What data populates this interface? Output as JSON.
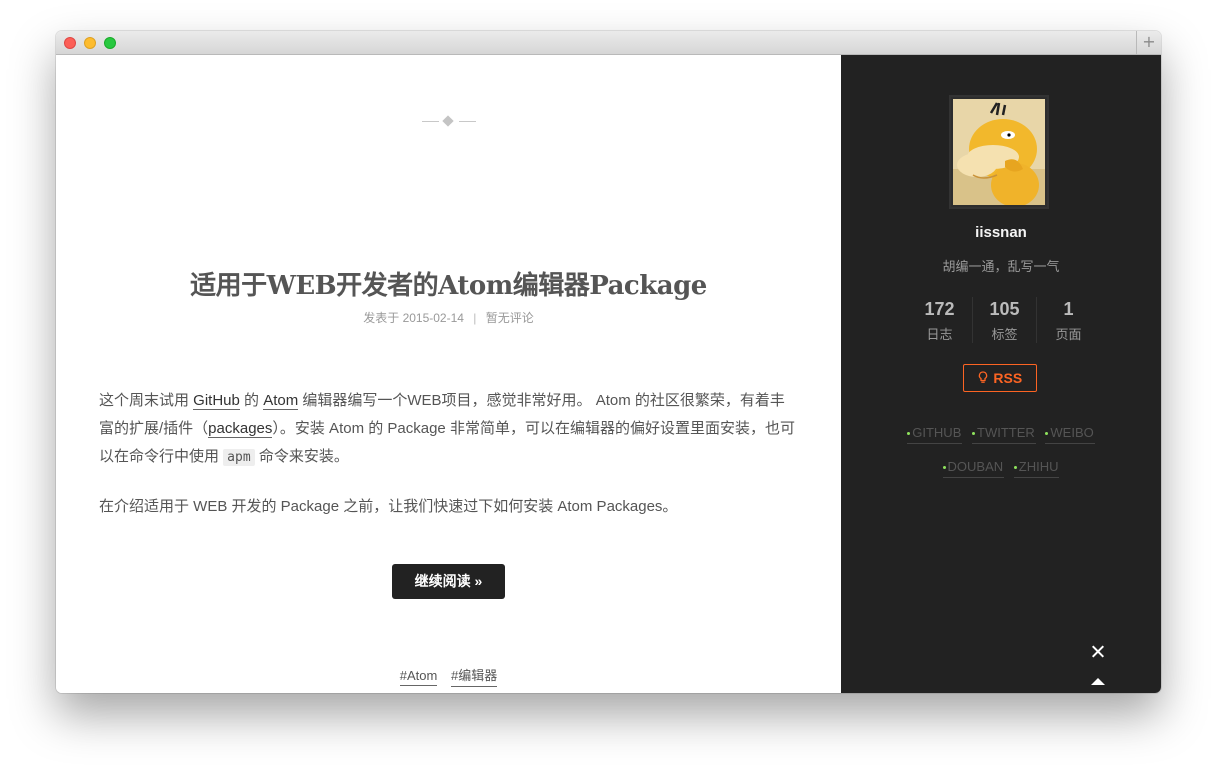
{
  "post": {
    "title": "适用于WEB开发者的Atom编辑器Package",
    "meta": {
      "posted_prefix": "发表于",
      "date": "2015-02-14",
      "separator": "|",
      "comments": "暂无评论"
    },
    "body": {
      "p1": {
        "t1": "这个周末试用 ",
        "link_github": "GitHub",
        "t2": " 的 ",
        "link_atom": "Atom",
        "t3": " 编辑器编写一个WEB项目，感觉非常好用。 Atom 的社区很繁荣，有着丰富的扩展/插件（",
        "link_packages": "packages",
        "t4": "）。安装 Atom 的 Package 非常简单，可以在编辑器的偏好设置里面安装，也可以在命令行中使用 ",
        "code_apm": "apm",
        "t5": " 命令来安装。"
      },
      "p2": "在介绍适用于 WEB 开发的 Package 之前，让我们快速过下如何安装 Atom Packages。"
    },
    "read_more": "继续阅读 »",
    "tags": [
      "#Atom",
      "#编辑器"
    ]
  },
  "sidebar": {
    "author": "iissnan",
    "motto": "胡编一通，乱写一气",
    "stats": [
      {
        "count": "172",
        "label": "日志"
      },
      {
        "count": "105",
        "label": "标签"
      },
      {
        "count": "1",
        "label": "页面"
      }
    ],
    "rss": "RSS",
    "links": [
      "GITHUB",
      "TWITTER",
      "WEIBO",
      "DOUBAN",
      "ZHIHU"
    ]
  },
  "icons": {
    "ornament": "diamond-ornament-icon",
    "rss": "lightbulb-icon",
    "close": "close-icon",
    "back_to_top": "triangle-up-icon"
  },
  "colors": {
    "sidebar_bg": "#222222",
    "rss_accent": "#fc6423",
    "link_dot": "#8fe35d",
    "button_bg": "#222222"
  }
}
